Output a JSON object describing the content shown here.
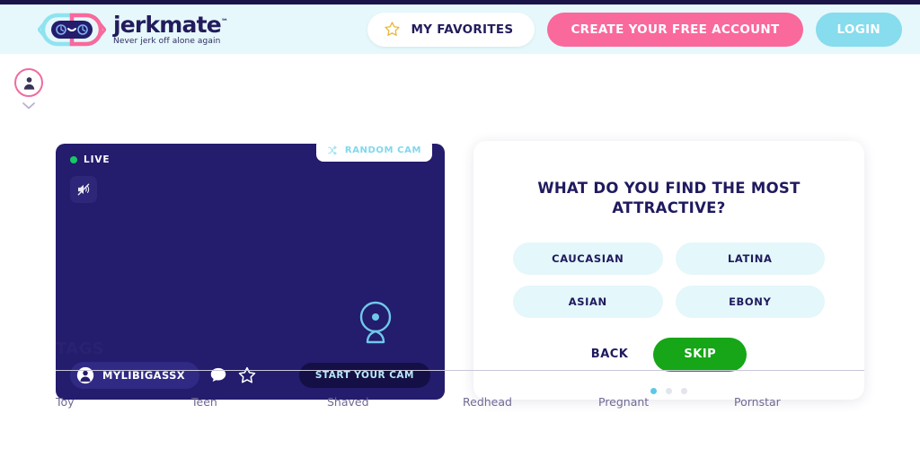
{
  "brand": {
    "name": "jerkmate",
    "trademark": "™",
    "tagline": "Never jerk off alone again",
    "logo_icon": "robot-face-icon",
    "colors": {
      "navy": "#241c6d",
      "pink": "#f9699c",
      "cyan": "#87dced",
      "header_bg": "#e6f8fb",
      "green": "#16a617"
    }
  },
  "header": {
    "favorites_label": "MY FAVORITES",
    "favorites_icon": "star-icon",
    "create_account_label": "CREATE YOUR FREE ACCOUNT",
    "login_label": "LOGIN"
  },
  "left_rail": {
    "avatar_icon": "user-avatar-icon",
    "chevron_icon": "chevron-down-icon"
  },
  "player": {
    "live_label": "LIVE",
    "mute_icon": "speaker-muted-icon",
    "random_cam_label": "RANDOM CAM",
    "random_cam_icon": "shuffle-icon",
    "webcam_icon": "webcam-icon",
    "username": "MYLIBIGASSX",
    "user_icon": "user-circle-icon",
    "chat_icon": "chat-bubble-icon",
    "favorite_icon": "star-outline-icon",
    "start_cam_label": "START YOUR CAM"
  },
  "quiz": {
    "title": "WHAT DO YOU FIND THE MOST ATTRACTIVE?",
    "options": [
      "CAUCASIAN",
      "LATINA",
      "ASIAN",
      "EBONY"
    ],
    "back_label": "BACK",
    "skip_label": "SKIP",
    "dots": [
      {
        "active": true
      },
      {
        "active": false
      },
      {
        "active": false
      }
    ]
  },
  "tags": {
    "heading": "TAGS",
    "items": [
      "Toy",
      "Teen",
      "Shaved",
      "Redhead",
      "Pregnant",
      "Pornstar"
    ]
  }
}
